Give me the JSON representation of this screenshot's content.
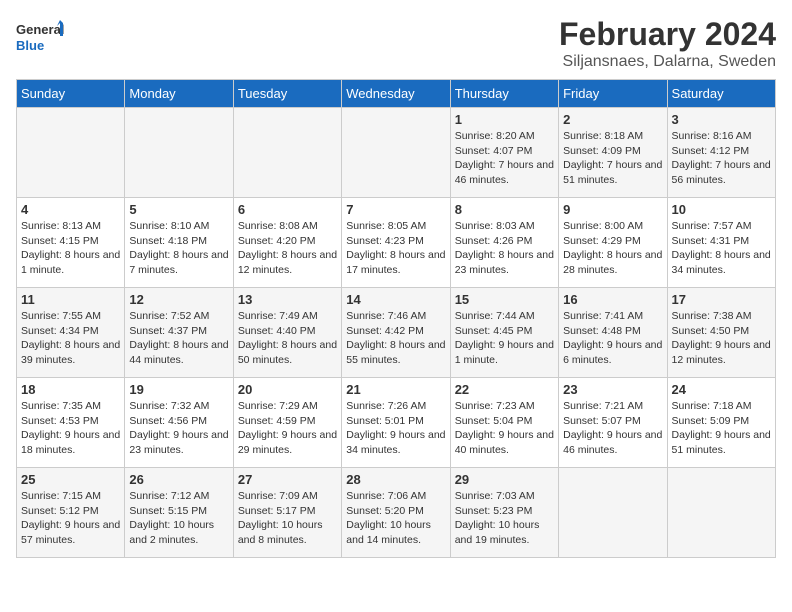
{
  "logo": {
    "text_general": "General",
    "text_blue": "Blue"
  },
  "header": {
    "main_title": "February 2024",
    "sub_title": "Siljansnaes, Dalarna, Sweden"
  },
  "weekdays": [
    "Sunday",
    "Monday",
    "Tuesday",
    "Wednesday",
    "Thursday",
    "Friday",
    "Saturday"
  ],
  "weeks": [
    [
      {
        "day": "",
        "sunrise": "",
        "sunset": "",
        "daylight": ""
      },
      {
        "day": "",
        "sunrise": "",
        "sunset": "",
        "daylight": ""
      },
      {
        "day": "",
        "sunrise": "",
        "sunset": "",
        "daylight": ""
      },
      {
        "day": "",
        "sunrise": "",
        "sunset": "",
        "daylight": ""
      },
      {
        "day": "1",
        "sunrise": "Sunrise: 8:20 AM",
        "sunset": "Sunset: 4:07 PM",
        "daylight": "Daylight: 7 hours and 46 minutes."
      },
      {
        "day": "2",
        "sunrise": "Sunrise: 8:18 AM",
        "sunset": "Sunset: 4:09 PM",
        "daylight": "Daylight: 7 hours and 51 minutes."
      },
      {
        "day": "3",
        "sunrise": "Sunrise: 8:16 AM",
        "sunset": "Sunset: 4:12 PM",
        "daylight": "Daylight: 7 hours and 56 minutes."
      }
    ],
    [
      {
        "day": "4",
        "sunrise": "Sunrise: 8:13 AM",
        "sunset": "Sunset: 4:15 PM",
        "daylight": "Daylight: 8 hours and 1 minute."
      },
      {
        "day": "5",
        "sunrise": "Sunrise: 8:10 AM",
        "sunset": "Sunset: 4:18 PM",
        "daylight": "Daylight: 8 hours and 7 minutes."
      },
      {
        "day": "6",
        "sunrise": "Sunrise: 8:08 AM",
        "sunset": "Sunset: 4:20 PM",
        "daylight": "Daylight: 8 hours and 12 minutes."
      },
      {
        "day": "7",
        "sunrise": "Sunrise: 8:05 AM",
        "sunset": "Sunset: 4:23 PM",
        "daylight": "Daylight: 8 hours and 17 minutes."
      },
      {
        "day": "8",
        "sunrise": "Sunrise: 8:03 AM",
        "sunset": "Sunset: 4:26 PM",
        "daylight": "Daylight: 8 hours and 23 minutes."
      },
      {
        "day": "9",
        "sunrise": "Sunrise: 8:00 AM",
        "sunset": "Sunset: 4:29 PM",
        "daylight": "Daylight: 8 hours and 28 minutes."
      },
      {
        "day": "10",
        "sunrise": "Sunrise: 7:57 AM",
        "sunset": "Sunset: 4:31 PM",
        "daylight": "Daylight: 8 hours and 34 minutes."
      }
    ],
    [
      {
        "day": "11",
        "sunrise": "Sunrise: 7:55 AM",
        "sunset": "Sunset: 4:34 PM",
        "daylight": "Daylight: 8 hours and 39 minutes."
      },
      {
        "day": "12",
        "sunrise": "Sunrise: 7:52 AM",
        "sunset": "Sunset: 4:37 PM",
        "daylight": "Daylight: 8 hours and 44 minutes."
      },
      {
        "day": "13",
        "sunrise": "Sunrise: 7:49 AM",
        "sunset": "Sunset: 4:40 PM",
        "daylight": "Daylight: 8 hours and 50 minutes."
      },
      {
        "day": "14",
        "sunrise": "Sunrise: 7:46 AM",
        "sunset": "Sunset: 4:42 PM",
        "daylight": "Daylight: 8 hours and 55 minutes."
      },
      {
        "day": "15",
        "sunrise": "Sunrise: 7:44 AM",
        "sunset": "Sunset: 4:45 PM",
        "daylight": "Daylight: 9 hours and 1 minute."
      },
      {
        "day": "16",
        "sunrise": "Sunrise: 7:41 AM",
        "sunset": "Sunset: 4:48 PM",
        "daylight": "Daylight: 9 hours and 6 minutes."
      },
      {
        "day": "17",
        "sunrise": "Sunrise: 7:38 AM",
        "sunset": "Sunset: 4:50 PM",
        "daylight": "Daylight: 9 hours and 12 minutes."
      }
    ],
    [
      {
        "day": "18",
        "sunrise": "Sunrise: 7:35 AM",
        "sunset": "Sunset: 4:53 PM",
        "daylight": "Daylight: 9 hours and 18 minutes."
      },
      {
        "day": "19",
        "sunrise": "Sunrise: 7:32 AM",
        "sunset": "Sunset: 4:56 PM",
        "daylight": "Daylight: 9 hours and 23 minutes."
      },
      {
        "day": "20",
        "sunrise": "Sunrise: 7:29 AM",
        "sunset": "Sunset: 4:59 PM",
        "daylight": "Daylight: 9 hours and 29 minutes."
      },
      {
        "day": "21",
        "sunrise": "Sunrise: 7:26 AM",
        "sunset": "Sunset: 5:01 PM",
        "daylight": "Daylight: 9 hours and 34 minutes."
      },
      {
        "day": "22",
        "sunrise": "Sunrise: 7:23 AM",
        "sunset": "Sunset: 5:04 PM",
        "daylight": "Daylight: 9 hours and 40 minutes."
      },
      {
        "day": "23",
        "sunrise": "Sunrise: 7:21 AM",
        "sunset": "Sunset: 5:07 PM",
        "daylight": "Daylight: 9 hours and 46 minutes."
      },
      {
        "day": "24",
        "sunrise": "Sunrise: 7:18 AM",
        "sunset": "Sunset: 5:09 PM",
        "daylight": "Daylight: 9 hours and 51 minutes."
      }
    ],
    [
      {
        "day": "25",
        "sunrise": "Sunrise: 7:15 AM",
        "sunset": "Sunset: 5:12 PM",
        "daylight": "Daylight: 9 hours and 57 minutes."
      },
      {
        "day": "26",
        "sunrise": "Sunrise: 7:12 AM",
        "sunset": "Sunset: 5:15 PM",
        "daylight": "Daylight: 10 hours and 2 minutes."
      },
      {
        "day": "27",
        "sunrise": "Sunrise: 7:09 AM",
        "sunset": "Sunset: 5:17 PM",
        "daylight": "Daylight: 10 hours and 8 minutes."
      },
      {
        "day": "28",
        "sunrise": "Sunrise: 7:06 AM",
        "sunset": "Sunset: 5:20 PM",
        "daylight": "Daylight: 10 hours and 14 minutes."
      },
      {
        "day": "29",
        "sunrise": "Sunrise: 7:03 AM",
        "sunset": "Sunset: 5:23 PM",
        "daylight": "Daylight: 10 hours and 19 minutes."
      },
      {
        "day": "",
        "sunrise": "",
        "sunset": "",
        "daylight": ""
      },
      {
        "day": "",
        "sunrise": "",
        "sunset": "",
        "daylight": ""
      }
    ]
  ]
}
